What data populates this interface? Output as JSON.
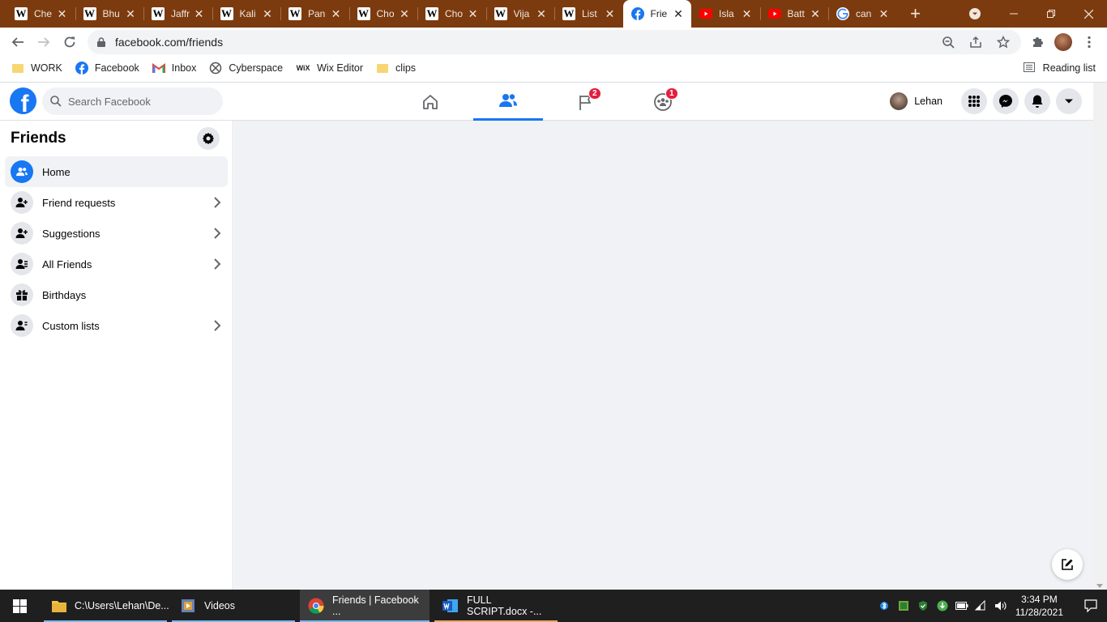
{
  "browser": {
    "tabs": [
      {
        "favicon": "wikipedia",
        "title": "Che"
      },
      {
        "favicon": "wikipedia",
        "title": "Bhu"
      },
      {
        "favicon": "wikipedia",
        "title": "Jaffr"
      },
      {
        "favicon": "wikipedia",
        "title": "Kali"
      },
      {
        "favicon": "wikipedia",
        "title": "Pan"
      },
      {
        "favicon": "wikipedia",
        "title": "Cho"
      },
      {
        "favicon": "wikipedia",
        "title": "Cho"
      },
      {
        "favicon": "wikipedia",
        "title": "Vija"
      },
      {
        "favicon": "wikipedia",
        "title": "List"
      },
      {
        "favicon": "facebook",
        "title": "Frie",
        "active": true
      },
      {
        "favicon": "youtube",
        "title": "Isla"
      },
      {
        "favicon": "youtube",
        "title": "Batt"
      },
      {
        "favicon": "google",
        "title": "can"
      }
    ],
    "url": "facebook.com/friends",
    "bookmarks": [
      {
        "icon": "folder-icon",
        "label": "WORK"
      },
      {
        "icon": "facebook-icon",
        "label": "Facebook"
      },
      {
        "icon": "gmail-icon",
        "label": "Inbox"
      },
      {
        "icon": "cyberspace-icon",
        "label": "Cyberspace"
      },
      {
        "icon": "wix-icon",
        "label": "Wix Editor"
      },
      {
        "icon": "folder-icon",
        "label": "clips"
      }
    ],
    "reading_list": "Reading list",
    "colors": {
      "frame": "#7c3b0f"
    }
  },
  "facebook": {
    "search_placeholder": "Search Facebook",
    "nav": {
      "pages_badge": "2",
      "groups_badge": "1"
    },
    "profile_name": "Lehan",
    "colors": {
      "brand": "#1877f2",
      "badge": "#e41e3f"
    }
  },
  "sidebar": {
    "title": "Friends",
    "items": [
      {
        "label": "Home",
        "icon": "friends-home-icon"
      },
      {
        "label": "Friend requests",
        "icon": "friend-request-icon"
      },
      {
        "label": "Suggestions",
        "icon": "suggestions-icon"
      },
      {
        "label": "All Friends",
        "icon": "all-friends-icon"
      },
      {
        "label": "Birthdays",
        "icon": "gift-icon"
      },
      {
        "label": "Custom lists",
        "icon": "custom-list-icon"
      }
    ]
  },
  "taskbar": {
    "apps": [
      {
        "label": "C:\\Users\\Lehan\\De...",
        "icon": "file-explorer-icon"
      },
      {
        "label": "Videos",
        "icon": "videos-folder-icon"
      },
      {
        "label": "Friends | Facebook ...",
        "icon": "chrome-icon"
      },
      {
        "label": "FULL SCRIPT.docx -...",
        "icon": "word-icon"
      }
    ],
    "time": "3:34 PM",
    "date": "11/28/2021"
  }
}
